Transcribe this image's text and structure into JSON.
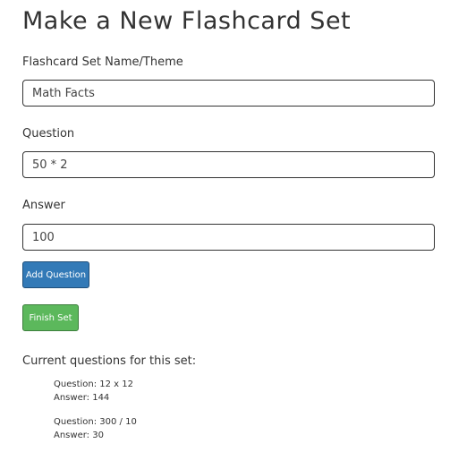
{
  "page": {
    "title": "Make a New Flashcard Set"
  },
  "form": {
    "set_name": {
      "label": "Flashcard Set Name/Theme",
      "value": "Math Facts"
    },
    "question": {
      "label": "Question",
      "value": "50 * 2"
    },
    "answer": {
      "label": "Answer",
      "value": "100"
    },
    "add_button_label": "Add Question",
    "finish_button_label": "Finish Set"
  },
  "current": {
    "heading": "Current questions for this set:",
    "items": [
      {
        "question": "Question: 12 x 12",
        "answer": "Answer: 144"
      },
      {
        "question": "Question: 300 / 10",
        "answer": "Answer: 30"
      }
    ]
  },
  "colors": {
    "primary_button": "#337ab7",
    "success_button": "#5cb85c"
  }
}
